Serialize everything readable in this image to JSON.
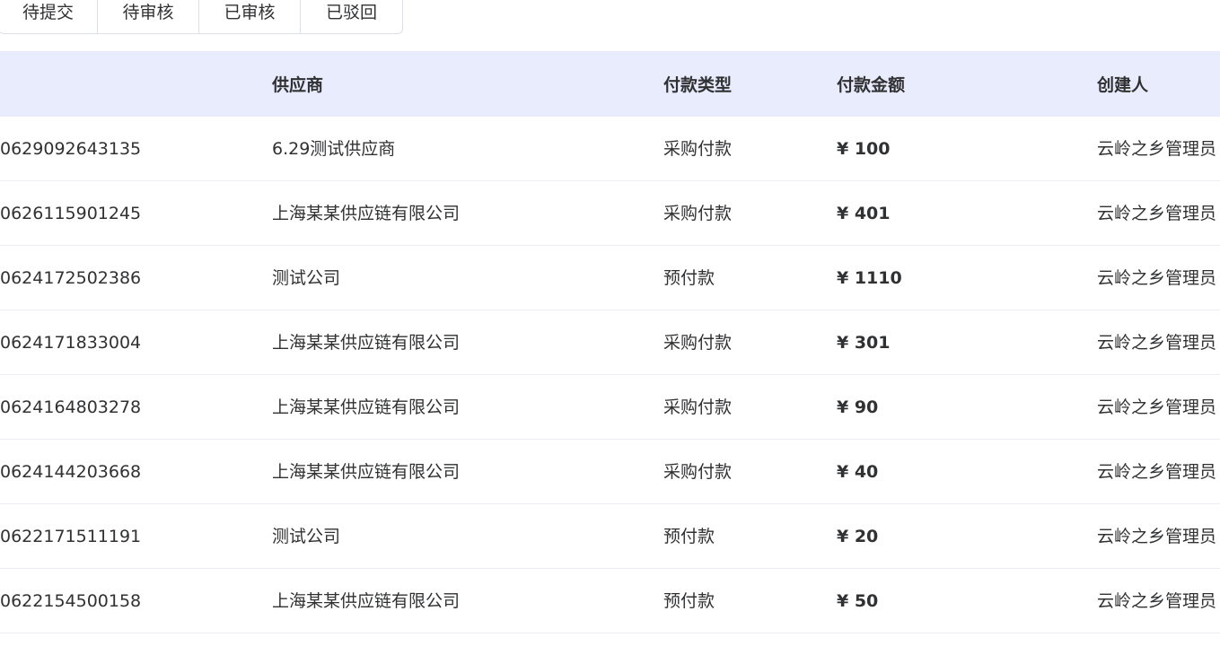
{
  "tabs": [
    "待提交",
    "待审核",
    "已审核",
    "已驳回"
  ],
  "table": {
    "headers": {
      "first": "-",
      "supplier": "供应商",
      "type": "付款类型",
      "amount": "付款金额",
      "creator": "创建人"
    },
    "rows": [
      {
        "no": "0629092643135",
        "supplier": "6.29测试供应商",
        "type": "采购付款",
        "amount": "¥ 100",
        "creator": "云岭之乡管理员"
      },
      {
        "no": "0626115901245",
        "supplier": "上海某某供应链有限公司",
        "type": "采购付款",
        "amount": "¥ 401",
        "creator": "云岭之乡管理员"
      },
      {
        "no": "0624172502386",
        "supplier": "测试公司",
        "type": "预付款",
        "amount": "¥ 1110",
        "creator": "云岭之乡管理员"
      },
      {
        "no": "0624171833004",
        "supplier": "上海某某供应链有限公司",
        "type": "采购付款",
        "amount": "¥ 301",
        "creator": "云岭之乡管理员"
      },
      {
        "no": "0624164803278",
        "supplier": "上海某某供应链有限公司",
        "type": "采购付款",
        "amount": "¥ 90",
        "creator": "云岭之乡管理员"
      },
      {
        "no": "0624144203668",
        "supplier": "上海某某供应链有限公司",
        "type": "采购付款",
        "amount": "¥ 40",
        "creator": "云岭之乡管理员"
      },
      {
        "no": "0622171511191",
        "supplier": "测试公司",
        "type": "预付款",
        "amount": "¥ 20",
        "creator": "云岭之乡管理员"
      },
      {
        "no": "0622154500158",
        "supplier": "上海某某供应链有限公司",
        "type": "预付款",
        "amount": "¥ 50",
        "creator": "云岭之乡管理员"
      }
    ]
  }
}
